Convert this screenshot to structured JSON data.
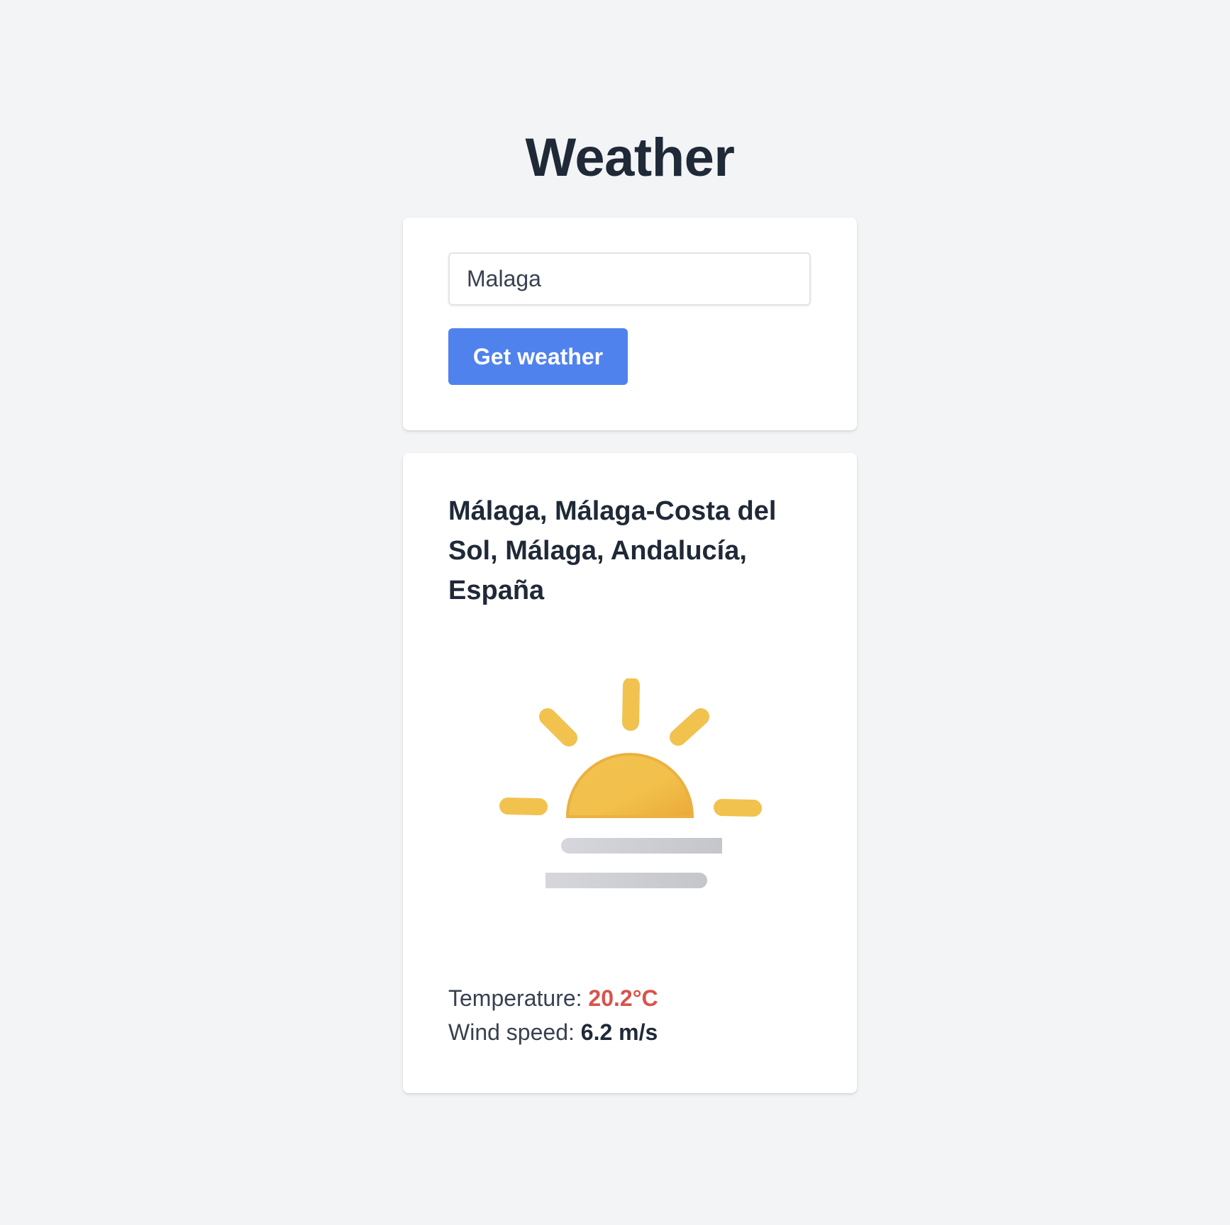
{
  "header": {
    "title": "Weather"
  },
  "search": {
    "value": "Malaga",
    "button_label": "Get weather"
  },
  "result": {
    "location": "Málaga, Málaga-Costa del Sol, Málaga, Andalucía, España",
    "icon": "sunrise-fog-icon",
    "temperature_label": "Temperature:",
    "temperature_value": "20.2°C",
    "wind_label": "Wind speed:",
    "wind_value": "6.2 m/s"
  },
  "colors": {
    "background": "#f3f4f6",
    "accent": "#5082ee",
    "temperature": "#d9534a",
    "sun": "#f2c04d",
    "fog": "#cfd1d7"
  }
}
